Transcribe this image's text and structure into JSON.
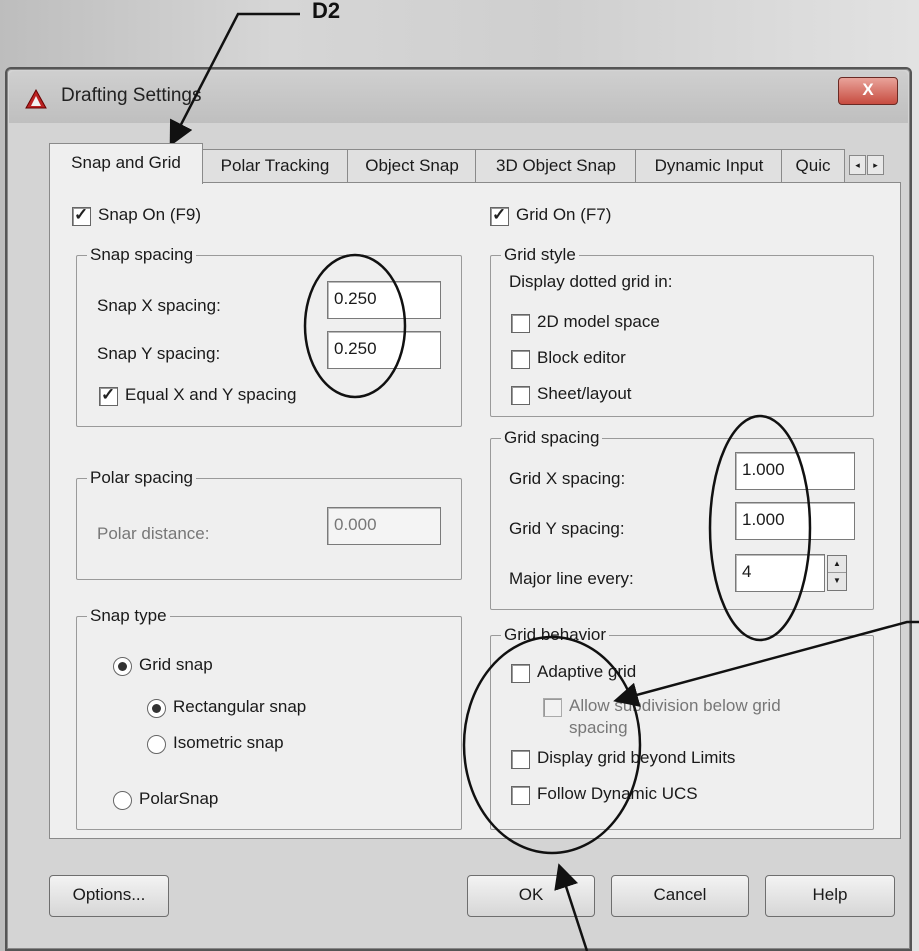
{
  "callout": {
    "label": "D2"
  },
  "window": {
    "title": "Drafting Settings",
    "close_symbol": "X"
  },
  "tabs": [
    {
      "label": "Snap and Grid"
    },
    {
      "label": "Polar Tracking"
    },
    {
      "label": "Object Snap"
    },
    {
      "label": "3D Object Snap"
    },
    {
      "label": "Dynamic Input"
    },
    {
      "label": "Quic"
    }
  ],
  "tab_scroll": {
    "left": "◂",
    "right": "▸"
  },
  "snap": {
    "on_label": "Snap On (F9)",
    "on_checked": true,
    "spacing_title": "Snap spacing",
    "x_label": "Snap X spacing:",
    "x_value": "0.250",
    "y_label": "Snap Y spacing:",
    "y_value": "0.250",
    "equal_label": "Equal X and Y spacing",
    "equal_checked": true
  },
  "polar": {
    "title": "Polar spacing",
    "distance_label": "Polar distance:",
    "distance_value": "0.000"
  },
  "snap_type": {
    "title": "Snap type",
    "grid_snap": "Grid snap",
    "rectangular": "Rectangular snap",
    "isometric": "Isometric snap",
    "polarsnap": "PolarSnap"
  },
  "grid": {
    "on_label": "Grid On (F7)",
    "on_checked": true,
    "style_title": "Grid style",
    "style_caption": "Display dotted grid in:",
    "model_space": "2D model space",
    "block_editor": "Block editor",
    "sheet_layout": "Sheet/layout",
    "spacing_title": "Grid spacing",
    "x_label": "Grid X spacing:",
    "x_value": "1.000",
    "y_label": "Grid Y spacing:",
    "y_value": "1.000",
    "major_label": "Major line every:",
    "major_value": "4",
    "behavior_title": "Grid behavior",
    "adaptive": "Adaptive grid",
    "subdivision_line1": "Allow subdivision below grid",
    "subdivision_line2": "spacing",
    "beyond_limits": "Display grid beyond Limits",
    "follow_ucs": "Follow Dynamic UCS"
  },
  "buttons": {
    "options": "Options...",
    "ok": "OK",
    "cancel": "Cancel",
    "help": "Help"
  }
}
